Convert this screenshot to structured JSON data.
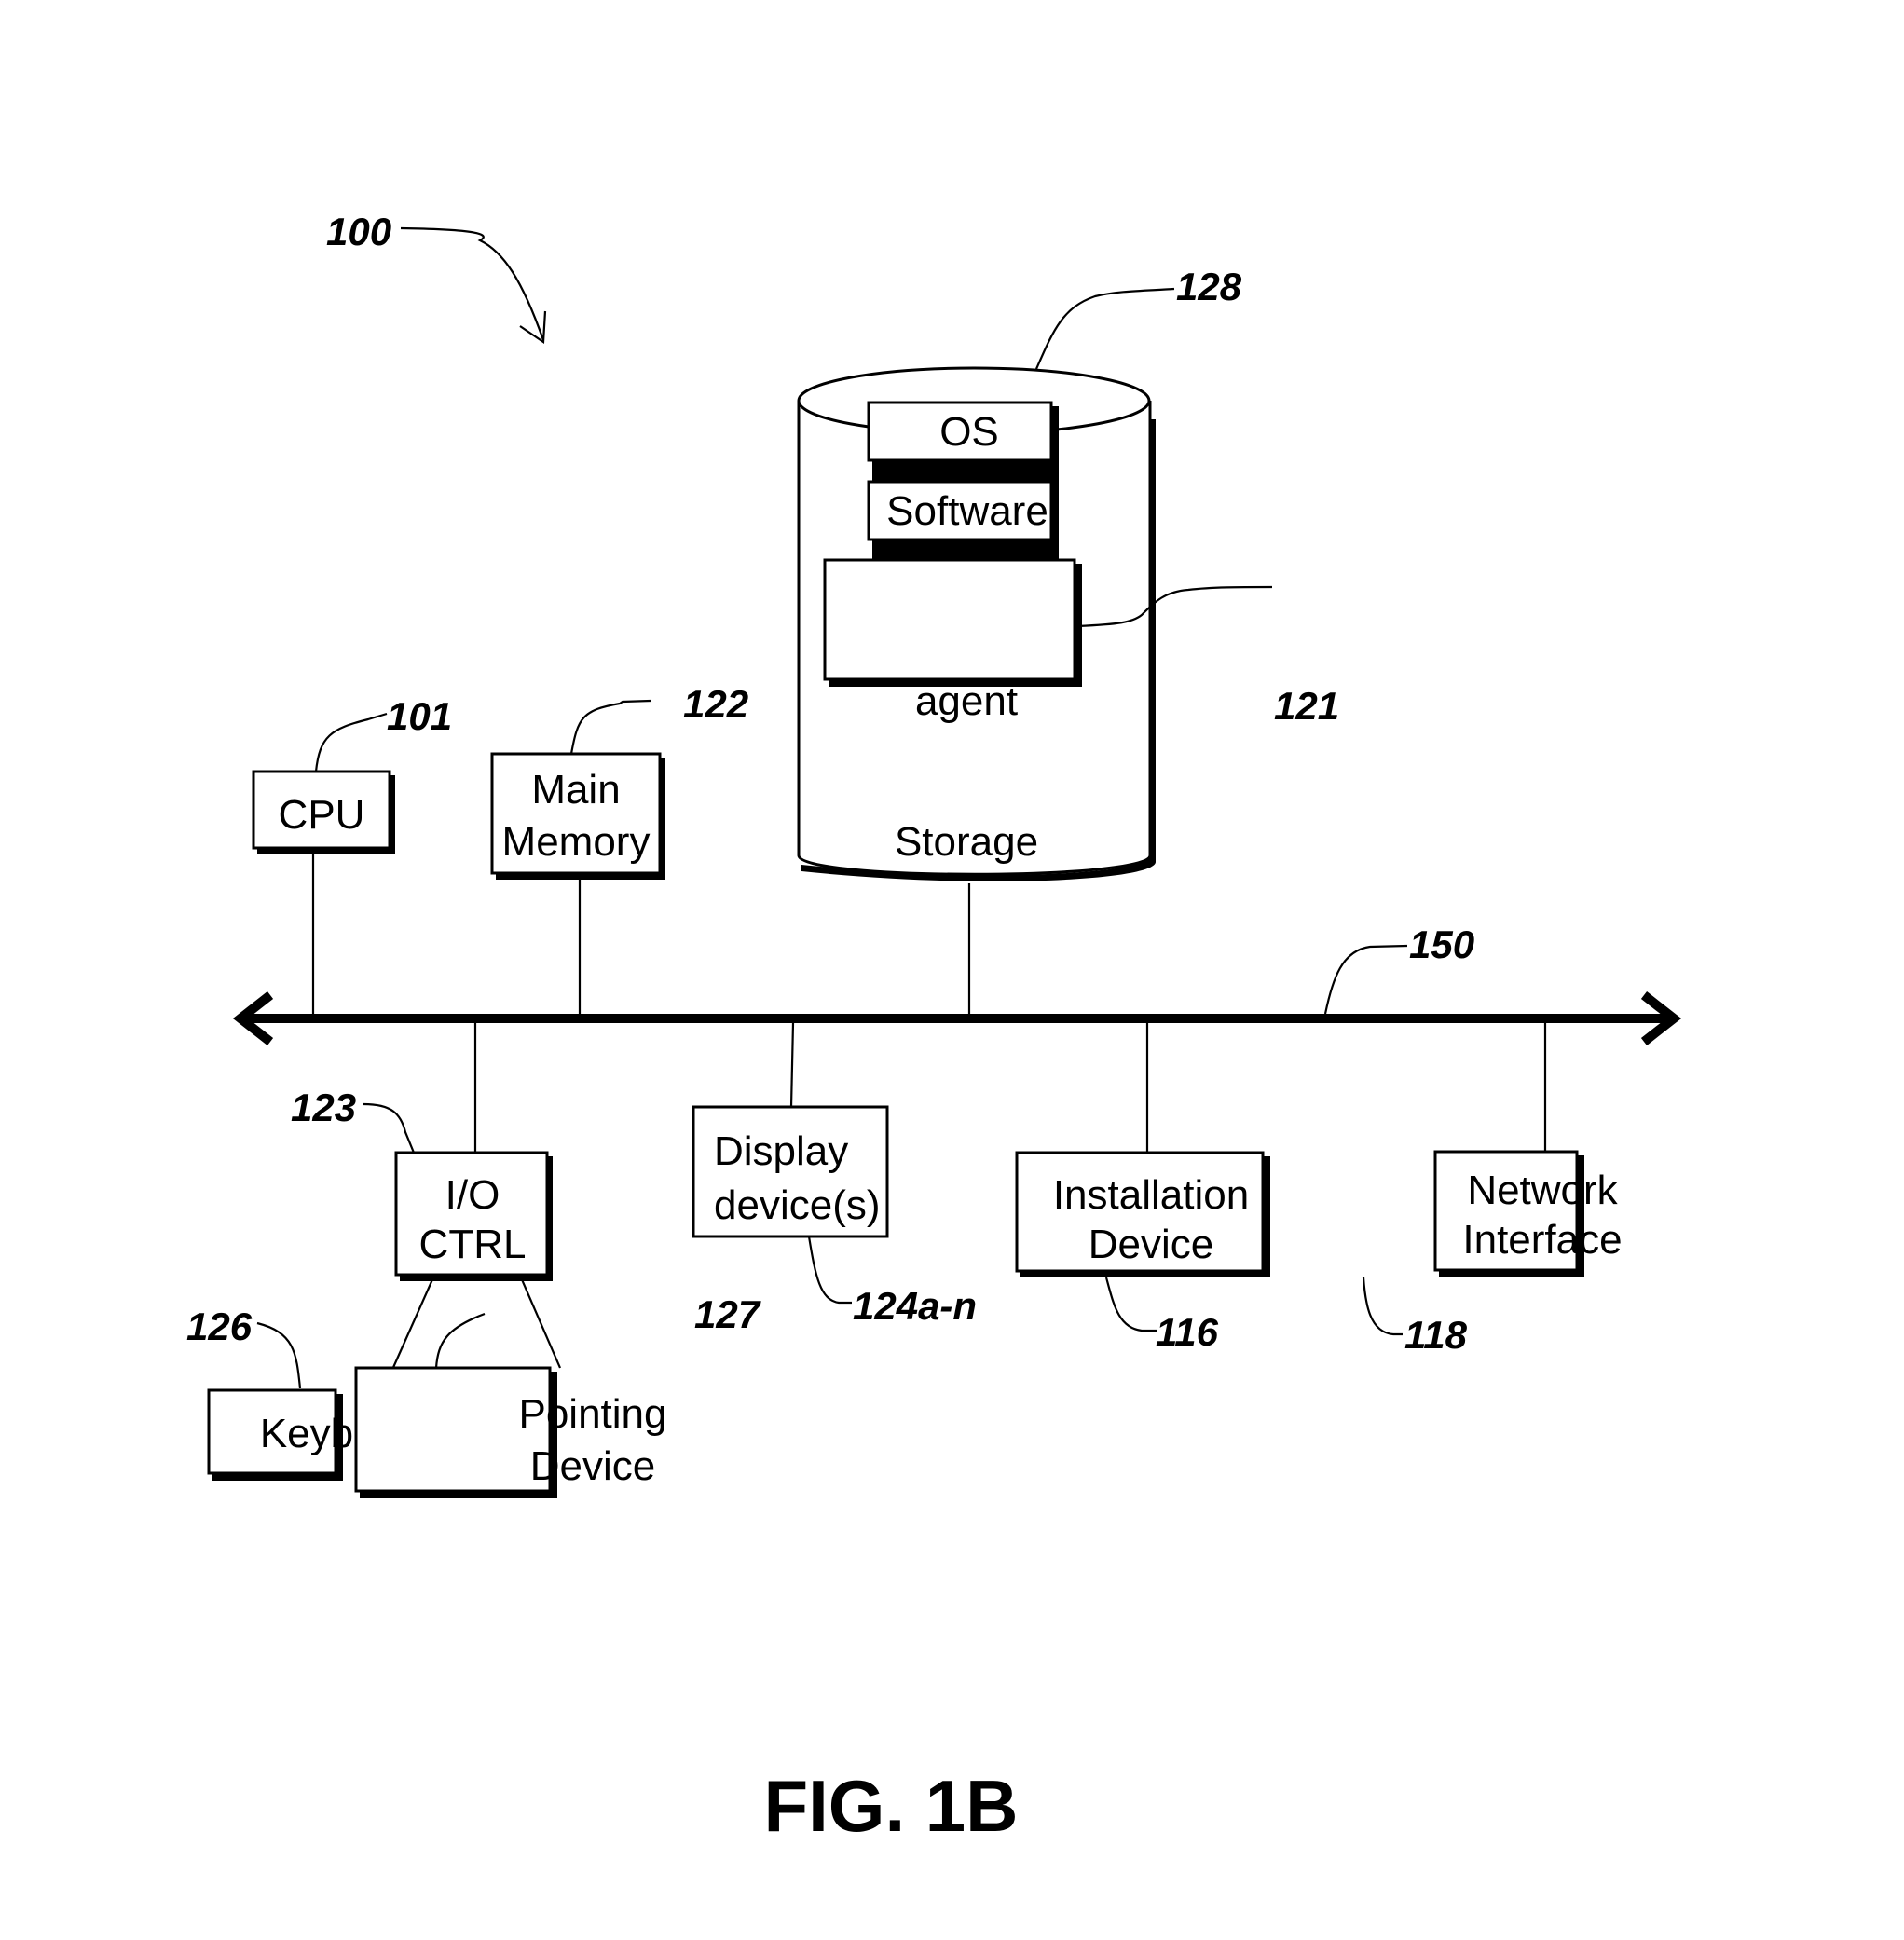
{
  "figure": {
    "caption": "FIG. 1B",
    "system_ref": "100"
  },
  "storage": {
    "ref": "128",
    "label": "Storage",
    "os_label": "OS",
    "software_label": "Software",
    "agent_label": "agent",
    "agent_ref": "121"
  },
  "cpu": {
    "label": "CPU",
    "ref": "101"
  },
  "main_memory": {
    "line1": "Main",
    "line2": "Memory",
    "ref": "122"
  },
  "bus": {
    "ref": "150"
  },
  "io_ctrl": {
    "line1": "I/O",
    "line2": "CTRL",
    "ref": "123"
  },
  "display": {
    "line1": "Display",
    "line2": "device(s)",
    "ref": "124a-n"
  },
  "installation": {
    "line1": "Installation",
    "line2": "Device",
    "ref": "116"
  },
  "network": {
    "line1": "Network",
    "line2": "Interface",
    "ref": "118"
  },
  "keyboard": {
    "label": "Keyboard",
    "ref": "126"
  },
  "pointing": {
    "line1": "Pointing",
    "line2": "Device",
    "ref": "127"
  }
}
